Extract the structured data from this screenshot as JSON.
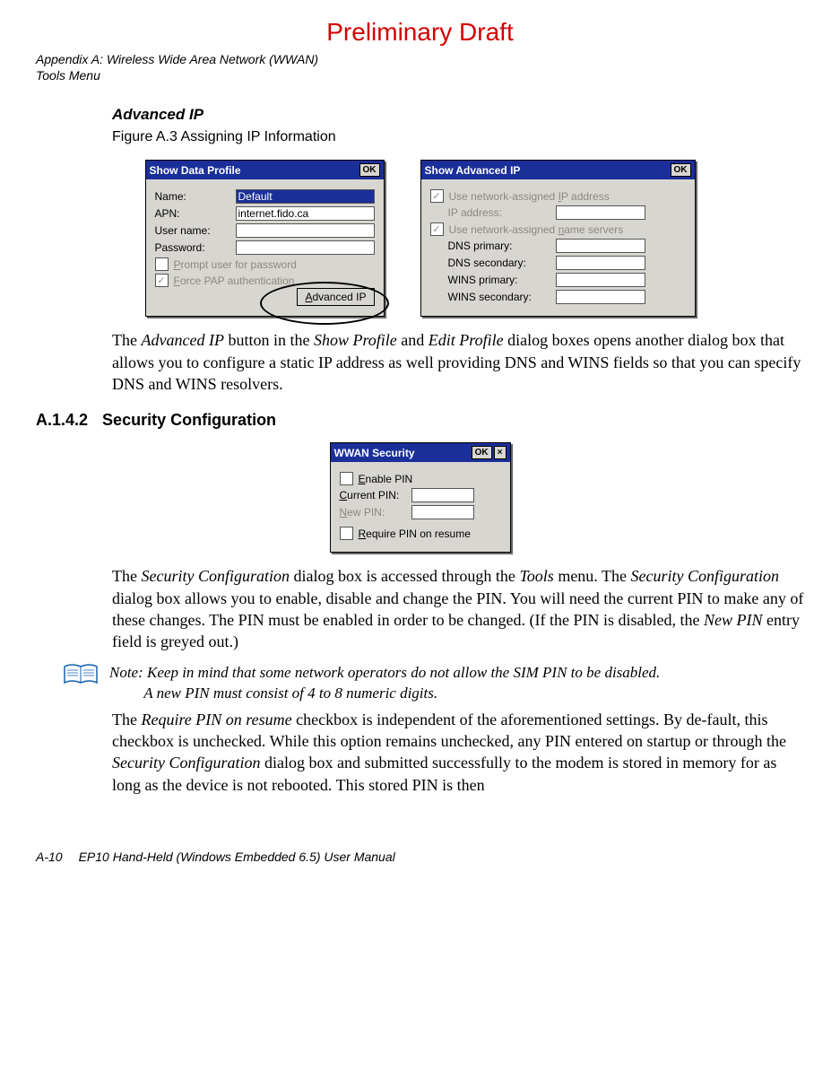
{
  "watermark": "Preliminary Draft",
  "header": {
    "line1": "Appendix A: Wireless Wide Area Network (WWAN)",
    "line2": "Tools Menu"
  },
  "advancedIP": {
    "heading": "Advanced IP",
    "figureCaption": "Figure A.3  Assigning IP Information",
    "para_pre": "The ",
    "para_i1": "Advanced IP",
    "para_mid1": " button in the ",
    "para_i2": "Show Profile",
    "para_mid2": " and ",
    "para_i3": "Edit Profile",
    "para_post": " dialog boxes opens another dialog box that allows you to configure a static IP address as well providing DNS and WINS fields so that you can specify DNS and WINS resolvers."
  },
  "dlgProfile": {
    "title": "Show Data Profile",
    "ok": "OK",
    "labels": {
      "name": "Name:",
      "apn": "APN:",
      "user": "User name:",
      "pass": "Password:"
    },
    "values": {
      "name": "Default",
      "apn": "internet.fido.ca",
      "user": "",
      "pass": ""
    },
    "chk_prompt_pre": "P",
    "chk_prompt_post": "rompt user for password",
    "chk_pap_pre": "F",
    "chk_pap_post": "orce PAP authentication",
    "btn_adv_pre": "A",
    "btn_adv_post": "dvanced IP"
  },
  "dlgAdvIP": {
    "title": "Show Advanced IP",
    "ok": "OK",
    "chk_ip_pre": "Use network-assigned ",
    "chk_ip_u": "I",
    "chk_ip_post": "P address",
    "lbl_ip": "IP address:",
    "chk_ns_pre": "Use network-assigned ",
    "chk_ns_u": "n",
    "chk_ns_post": "ame servers",
    "lbl_dns1": "DNS primary:",
    "lbl_dns2": "DNS secondary:",
    "lbl_wins1": "WINS primary:",
    "lbl_wins2": "WINS secondary:"
  },
  "section": {
    "num": "A.1.4.2",
    "title": "Security Configuration"
  },
  "dlgSec": {
    "title": "WWAN Security",
    "ok": "OK",
    "x": "×",
    "chk_enable_u": "E",
    "chk_enable_post": "nable PIN",
    "lbl_cur_u": "C",
    "lbl_cur_post": "urrent PIN:",
    "lbl_new_u": "N",
    "lbl_new_post": "ew PIN:",
    "chk_req_u": "R",
    "chk_req_post": "equire PIN on resume"
  },
  "secPara1": {
    "t1": "The ",
    "i1": "Security Configuration",
    "t2": " dialog box is accessed through the ",
    "i2": "Tools",
    "t3": " menu. The ",
    "i3": "Security Configuration",
    "t4": " dialog box allows you to enable, disable and change the PIN. You will need the current PIN to make any of these changes. The PIN must be enabled in order to be changed. (If the PIN is disabled, the ",
    "i4": "New PIN",
    "t5": " entry field is greyed out.)"
  },
  "note": {
    "label": "Note:",
    "text": " Keep in mind that some network operators do not allow the SIM PIN to be disabled. A new PIN must consist of 4 to 8 numeric digits."
  },
  "secPara2": {
    "t1": "The ",
    "i1": "Require PIN on resume",
    "t2": " checkbox is independent of the aforementioned settings. By de-fault, this checkbox is unchecked. While this option remains unchecked, any PIN entered on startup or through the ",
    "i2": "Security Configuration",
    "t3": " dialog box and submitted successfully to the modem is stored in memory for as long as the device is not rebooted. This stored PIN is then"
  },
  "footer": {
    "page": "A-10",
    "manual": "EP10 Hand-Held (Windows Embedded 6.5) User Manual"
  }
}
